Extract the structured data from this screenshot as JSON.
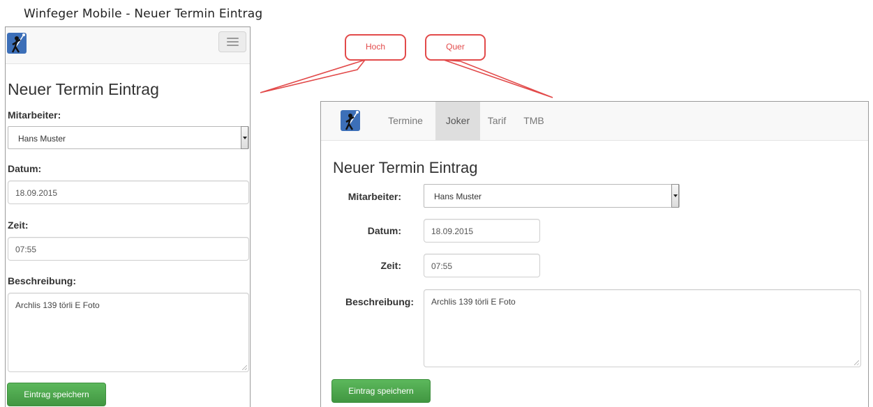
{
  "page": {
    "title": "Winfeger Mobile - Neuer Termin Eintrag"
  },
  "callouts": {
    "portrait": "Hoch",
    "landscape": "Quer"
  },
  "portrait": {
    "form_title": "Neuer Termin Eintrag",
    "labels": {
      "employee": "Mitarbeiter:",
      "date": "Datum:",
      "time": "Zeit:",
      "description": "Beschreibung:"
    },
    "values": {
      "employee": "Hans Muster",
      "date": "18.09.2015",
      "time": "07:55",
      "description": "Archlis 139 törli E Foto"
    },
    "save_label": "Eintrag speichern"
  },
  "landscape": {
    "nav": [
      "Termine",
      "Joker",
      "Tarif",
      "TMB"
    ],
    "active_nav": "Joker",
    "form_title": "Neuer Termin Eintrag",
    "labels": {
      "employee": "Mitarbeiter:",
      "date": "Datum:",
      "time": "Zeit:",
      "description": "Beschreibung:"
    },
    "values": {
      "employee": "Hans Muster",
      "date": "18.09.2015",
      "time": "07:55",
      "description": "Archlis 139 törli E Foto"
    },
    "save_label": "Eintrag speichern"
  },
  "colors": {
    "accent_callout": "#e24a4a",
    "save_button": "#5cb85c",
    "logo": "#3c6fb8",
    "nav_active": "#dedede"
  },
  "icons": [
    "chimney-sweep-logo-icon",
    "hamburger-menu-icon",
    "select-arrow-icon",
    "resize-grip-icon"
  ]
}
